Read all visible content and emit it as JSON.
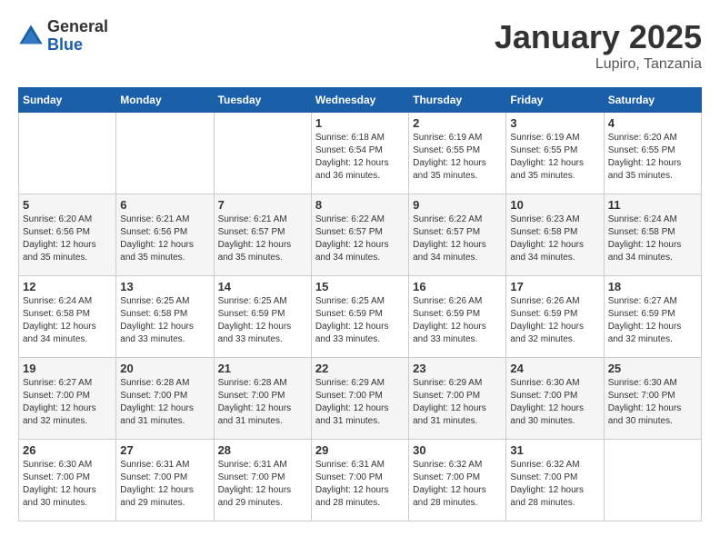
{
  "logo": {
    "general": "General",
    "blue": "Blue"
  },
  "title": "January 2025",
  "location": "Lupiro, Tanzania",
  "days_of_week": [
    "Sunday",
    "Monday",
    "Tuesday",
    "Wednesday",
    "Thursday",
    "Friday",
    "Saturday"
  ],
  "weeks": [
    [
      {
        "day": "",
        "info": ""
      },
      {
        "day": "",
        "info": ""
      },
      {
        "day": "",
        "info": ""
      },
      {
        "day": "1",
        "info": "Sunrise: 6:18 AM\nSunset: 6:54 PM\nDaylight: 12 hours\nand 36 minutes."
      },
      {
        "day": "2",
        "info": "Sunrise: 6:19 AM\nSunset: 6:55 PM\nDaylight: 12 hours\nand 35 minutes."
      },
      {
        "day": "3",
        "info": "Sunrise: 6:19 AM\nSunset: 6:55 PM\nDaylight: 12 hours\nand 35 minutes."
      },
      {
        "day": "4",
        "info": "Sunrise: 6:20 AM\nSunset: 6:55 PM\nDaylight: 12 hours\nand 35 minutes."
      }
    ],
    [
      {
        "day": "5",
        "info": "Sunrise: 6:20 AM\nSunset: 6:56 PM\nDaylight: 12 hours\nand 35 minutes."
      },
      {
        "day": "6",
        "info": "Sunrise: 6:21 AM\nSunset: 6:56 PM\nDaylight: 12 hours\nand 35 minutes."
      },
      {
        "day": "7",
        "info": "Sunrise: 6:21 AM\nSunset: 6:57 PM\nDaylight: 12 hours\nand 35 minutes."
      },
      {
        "day": "8",
        "info": "Sunrise: 6:22 AM\nSunset: 6:57 PM\nDaylight: 12 hours\nand 34 minutes."
      },
      {
        "day": "9",
        "info": "Sunrise: 6:22 AM\nSunset: 6:57 PM\nDaylight: 12 hours\nand 34 minutes."
      },
      {
        "day": "10",
        "info": "Sunrise: 6:23 AM\nSunset: 6:58 PM\nDaylight: 12 hours\nand 34 minutes."
      },
      {
        "day": "11",
        "info": "Sunrise: 6:24 AM\nSunset: 6:58 PM\nDaylight: 12 hours\nand 34 minutes."
      }
    ],
    [
      {
        "day": "12",
        "info": "Sunrise: 6:24 AM\nSunset: 6:58 PM\nDaylight: 12 hours\nand 34 minutes."
      },
      {
        "day": "13",
        "info": "Sunrise: 6:25 AM\nSunset: 6:58 PM\nDaylight: 12 hours\nand 33 minutes."
      },
      {
        "day": "14",
        "info": "Sunrise: 6:25 AM\nSunset: 6:59 PM\nDaylight: 12 hours\nand 33 minutes."
      },
      {
        "day": "15",
        "info": "Sunrise: 6:25 AM\nSunset: 6:59 PM\nDaylight: 12 hours\nand 33 minutes."
      },
      {
        "day": "16",
        "info": "Sunrise: 6:26 AM\nSunset: 6:59 PM\nDaylight: 12 hours\nand 33 minutes."
      },
      {
        "day": "17",
        "info": "Sunrise: 6:26 AM\nSunset: 6:59 PM\nDaylight: 12 hours\nand 32 minutes."
      },
      {
        "day": "18",
        "info": "Sunrise: 6:27 AM\nSunset: 6:59 PM\nDaylight: 12 hours\nand 32 minutes."
      }
    ],
    [
      {
        "day": "19",
        "info": "Sunrise: 6:27 AM\nSunset: 7:00 PM\nDaylight: 12 hours\nand 32 minutes."
      },
      {
        "day": "20",
        "info": "Sunrise: 6:28 AM\nSunset: 7:00 PM\nDaylight: 12 hours\nand 31 minutes."
      },
      {
        "day": "21",
        "info": "Sunrise: 6:28 AM\nSunset: 7:00 PM\nDaylight: 12 hours\nand 31 minutes."
      },
      {
        "day": "22",
        "info": "Sunrise: 6:29 AM\nSunset: 7:00 PM\nDaylight: 12 hours\nand 31 minutes."
      },
      {
        "day": "23",
        "info": "Sunrise: 6:29 AM\nSunset: 7:00 PM\nDaylight: 12 hours\nand 31 minutes."
      },
      {
        "day": "24",
        "info": "Sunrise: 6:30 AM\nSunset: 7:00 PM\nDaylight: 12 hours\nand 30 minutes."
      },
      {
        "day": "25",
        "info": "Sunrise: 6:30 AM\nSunset: 7:00 PM\nDaylight: 12 hours\nand 30 minutes."
      }
    ],
    [
      {
        "day": "26",
        "info": "Sunrise: 6:30 AM\nSunset: 7:00 PM\nDaylight: 12 hours\nand 30 minutes."
      },
      {
        "day": "27",
        "info": "Sunrise: 6:31 AM\nSunset: 7:00 PM\nDaylight: 12 hours\nand 29 minutes."
      },
      {
        "day": "28",
        "info": "Sunrise: 6:31 AM\nSunset: 7:00 PM\nDaylight: 12 hours\nand 29 minutes."
      },
      {
        "day": "29",
        "info": "Sunrise: 6:31 AM\nSunset: 7:00 PM\nDaylight: 12 hours\nand 28 minutes."
      },
      {
        "day": "30",
        "info": "Sunrise: 6:32 AM\nSunset: 7:00 PM\nDaylight: 12 hours\nand 28 minutes."
      },
      {
        "day": "31",
        "info": "Sunrise: 6:32 AM\nSunset: 7:00 PM\nDaylight: 12 hours\nand 28 minutes."
      },
      {
        "day": "",
        "info": ""
      }
    ]
  ]
}
